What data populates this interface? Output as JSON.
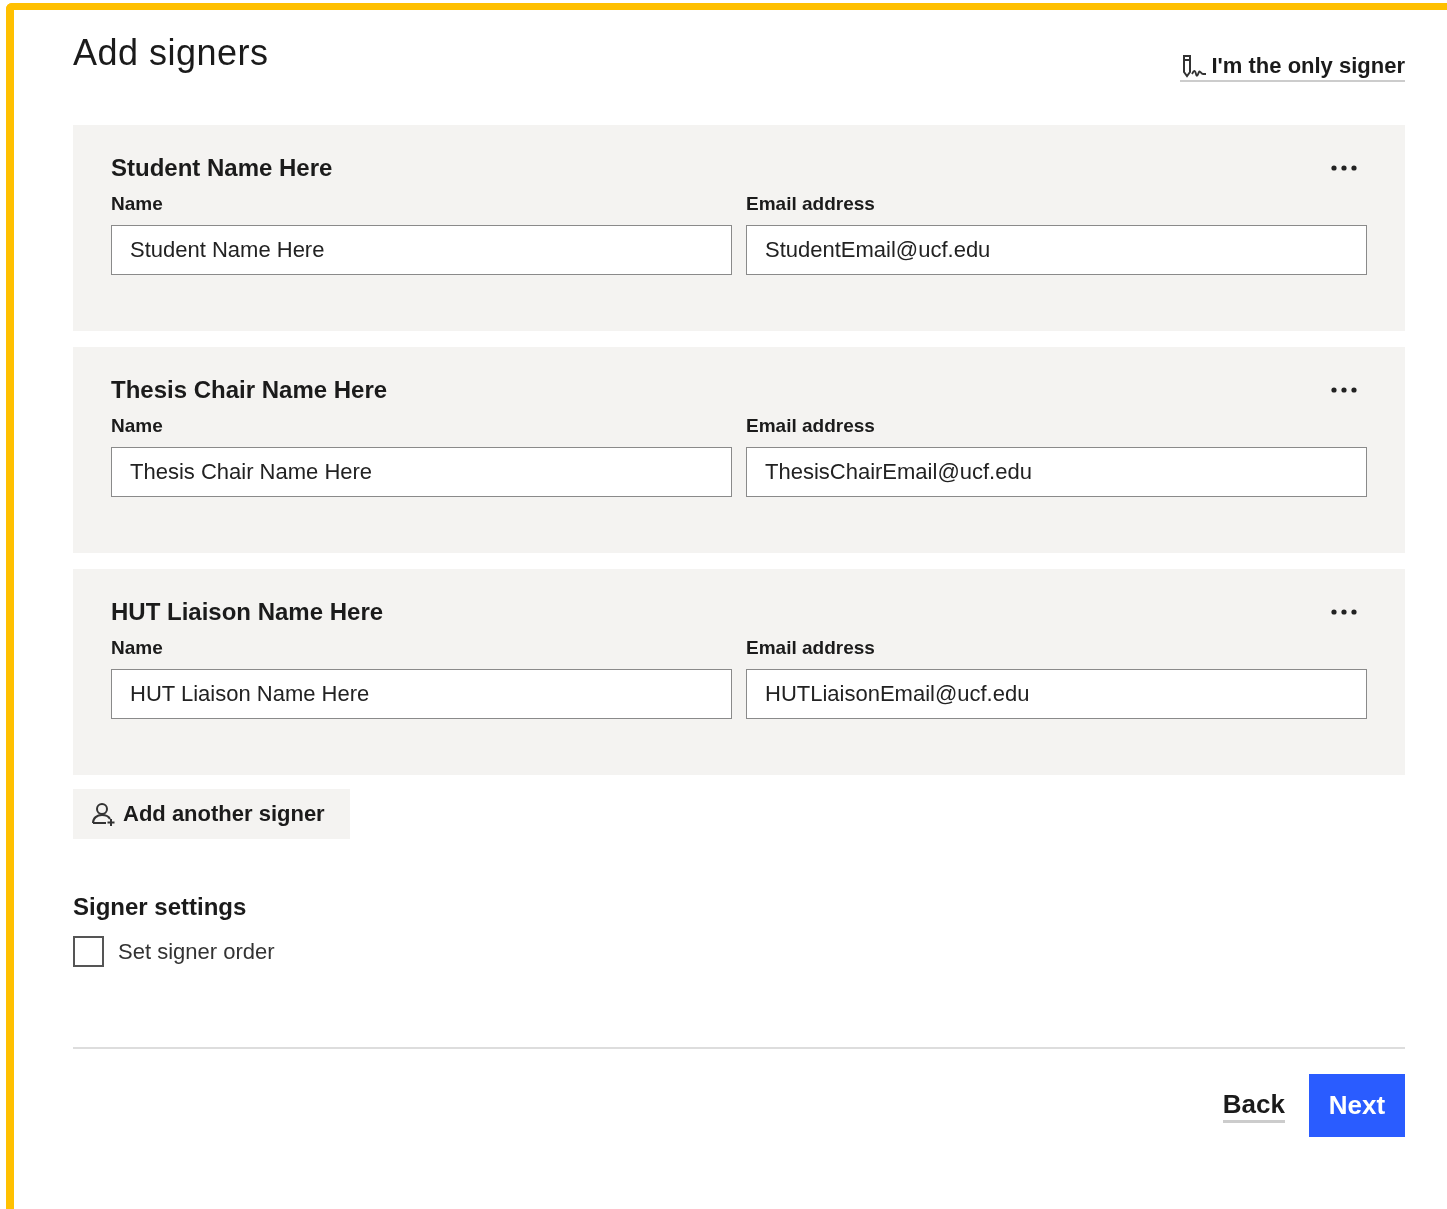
{
  "title": "Add signers",
  "only_signer_link": "I'm the only signer",
  "signers": [
    {
      "heading": "Student Name Here",
      "name_label": "Name",
      "name_value": "Student Name Here",
      "email_label": "Email address",
      "email_value": "StudentEmail@ucf.edu"
    },
    {
      "heading": "Thesis Chair Name Here",
      "name_label": "Name",
      "name_value": "Thesis Chair Name Here",
      "email_label": "Email address",
      "email_value": "ThesisChairEmail@ucf.edu"
    },
    {
      "heading": "HUT Liaison Name Here",
      "name_label": "Name",
      "name_value": "HUT Liaison Name Here",
      "email_label": "Email address",
      "email_value": "HUTLiaisonEmail@ucf.edu"
    }
  ],
  "add_signer_button": "Add another signer",
  "settings": {
    "heading": "Signer settings",
    "options": [
      {
        "label": "Set signer order",
        "checked": false
      }
    ]
  },
  "buttons": {
    "back": "Back",
    "next": "Next"
  }
}
